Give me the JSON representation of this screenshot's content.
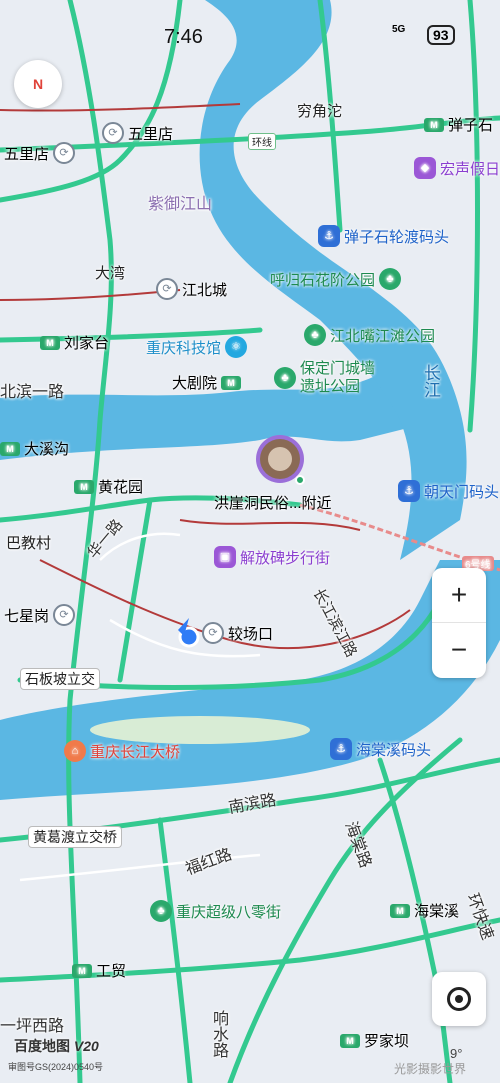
{
  "status_bar": {
    "time": "7:46",
    "battery": "93",
    "network": "5G"
  },
  "map": {
    "districts": {
      "qiongjiaotuo": "穷角沱",
      "wulidian_top": "五里店",
      "wulidian_left": "五里店",
      "ziyujiangshan": "紫御江山",
      "dawan": "大湾",
      "jiangbeicheng": "江北城",
      "liujiatai": "刘家台",
      "beibin_road": "北滨一路",
      "dajuyuan": "大剧院",
      "daxigou": "大溪沟",
      "huanghuayuan": "黄花园",
      "bajiaocun": "巴教村",
      "qixinggang": "七星岗",
      "jiaochangkou": "较场口",
      "shibanpo_bridge": "石板坡立交",
      "huanggedu_bridge": "黄葛渡立交桥",
      "gongmao": "工贸",
      "luojiaba": "罗家坝",
      "haitangxi": "海棠溪",
      "danzishi": "弹子石",
      "changjiang": "长江"
    },
    "pois": {
      "hongsheng_hotel": "宏声假日",
      "danzishi_ferry": "弹子石轮渡码头",
      "hugui_park": "呼归石花阶公园",
      "jiangbeizui_park": "江北嘴江滩公园",
      "chongqing_science_museum": "重庆科技馆",
      "baoding_wall_park_line1": "保定门城墙",
      "baoding_wall_park_line2": "遗址公园",
      "hongyadong": "洪崖洞民俗...附近",
      "chaotianmen": "朝天门码头",
      "jiefangbei": "解放碑步行街",
      "changjiang_bridge": "重庆长江大桥",
      "haitangxi_pier": "海棠溪码头",
      "bayi_street": "重庆超级八零街"
    },
    "roads": {
      "ring": "环线",
      "huayi_road": "华一路",
      "changbin_road": "长江滨江路",
      "nanbin_road": "南滨路",
      "fuhong_road": "福红路",
      "haitang_road": "海棠路",
      "ring_express": "环快速",
      "tuhe_road": "响水路",
      "ping_west": "一坪西路",
      "line6": "6号线"
    },
    "branding": {
      "logo": "百度地图",
      "version": "V20",
      "license": "审图号GS(2024)0540号",
      "watermark": "光影摄影世界"
    },
    "temperature": "9°",
    "compass": "N"
  },
  "controls": {
    "zoom_in": "+",
    "zoom_out": "−"
  },
  "colors": {
    "water": "#5bb7e3",
    "land": "#e9edf3",
    "road": "#33c98f",
    "road_dark": "#2aa86b"
  }
}
